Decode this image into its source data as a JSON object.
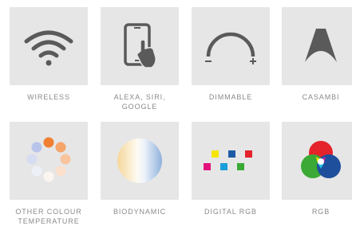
{
  "features": {
    "wireless": {
      "label": "WIRELESS"
    },
    "voice": {
      "label_line1": "ALEXA, SIRI,",
      "label_line2": "GOOGLE"
    },
    "dimmable": {
      "label": "DIMMABLE"
    },
    "casambi": {
      "label": "CASAMBI"
    },
    "colour_temperature": {
      "label_line1": "OTHER COLOUR",
      "label_line2": "TEMPERATURE"
    },
    "biodynamic": {
      "label": "BIODYNAMIC"
    },
    "digital_rgb": {
      "label": "DIGITAL RGB"
    },
    "rgb": {
      "label": "RGB"
    }
  },
  "colors": {
    "tile_background": "#e6e6e6",
    "icon_dark": "#5a5a5a",
    "label_text": "#8a8a8a",
    "rgb_red": "#e5232b",
    "rgb_green": "#3aa935",
    "rgb_blue": "#1e4f9c",
    "digital_yellow": "#f6e500",
    "digital_blue": "#1d5aa6",
    "digital_red": "#e5232b",
    "digital_magenta": "#e2127d",
    "digital_cyan": "#1a9ed9",
    "digital_green": "#3aa935",
    "warm_orange": "#f07f32"
  }
}
